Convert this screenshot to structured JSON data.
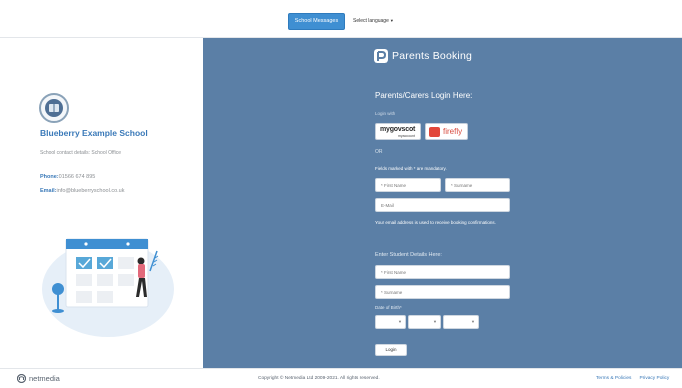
{
  "topbar": {
    "messages_button": "School Messages",
    "language_select": "Select language"
  },
  "school": {
    "name": "Blueberry Example School",
    "contact_details": "School contact details: School Office",
    "phone_label": "Phone:",
    "phone_value": "01566 674 895",
    "email_label": "Email:",
    "email_value": "info@blueberryschool.co.uk"
  },
  "login": {
    "brand": "Parents Booking",
    "heading": "Parents/Carers Login Here:",
    "login_with": "Login with",
    "mygovscot_top": "mygovscot",
    "mygovscot_bottom": "myaccount",
    "firefly": "firefly",
    "or": "OR",
    "mandatory_note": "Fields marked with * are mandatory.",
    "first_name_placeholder": "* First Name",
    "surname_placeholder": "* Surname",
    "email_placeholder": "E-Mail",
    "email_note": "Your email address is used to receive booking confirmations.",
    "student_heading": "Enter Student Details Here:",
    "student_first_name_placeholder": "* First Name",
    "student_surname_placeholder": "* Surname",
    "dob_label": "Date of Birth*",
    "login_button": "Login"
  },
  "footer": {
    "brand": "netmedia",
    "copyright": "Copyright © Netmedia Ltd 2009-2021. All rights reserved.",
    "terms": "Terms & Policies",
    "privacy": "Privacy Policy"
  },
  "colors": {
    "panel_blue": "#5b7fa6",
    "accent_blue": "#3f8fd2",
    "school_name": "#3a79b8"
  }
}
